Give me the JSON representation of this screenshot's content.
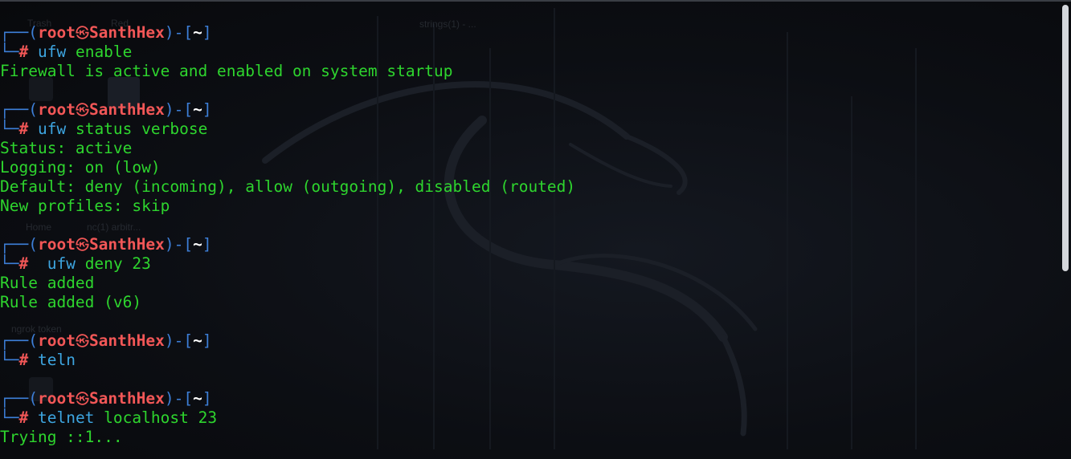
{
  "prompt": {
    "user": "root",
    "host": "SanthHex",
    "cwd": "~",
    "hash": "#"
  },
  "background_ghost_text": [
    "Trash",
    "Red",
    "strings(1) - ...",
    "Home",
    "nc(1) arbitr...",
    "ngrok token"
  ],
  "blocks": [
    {
      "command": "ufw",
      "args": " enable",
      "output": [
        "Firewall is active and enabled on system startup"
      ]
    },
    {
      "command": "ufw",
      "args": " status verbose",
      "output": [
        "Status: active",
        "Logging: on (low)",
        "Default: deny (incoming), allow (outgoing), disabled (routed)",
        "New profiles: skip"
      ]
    },
    {
      "command": " ufw",
      "args": " deny 23",
      "output": [
        "Rule added",
        "Rule added (v6)"
      ]
    },
    {
      "command": "teln",
      "args": "",
      "output": []
    },
    {
      "command": "telnet",
      "args": " localhost 23",
      "output": [
        "Trying ::1..."
      ]
    }
  ],
  "colors": {
    "frame": "#3d7fd8",
    "user": "#f25757",
    "command": "#3da5e0",
    "output": "#2ed52e",
    "background": "#0c0e13"
  },
  "icons": {
    "at_symbol": "kali-skull-at-icon"
  }
}
